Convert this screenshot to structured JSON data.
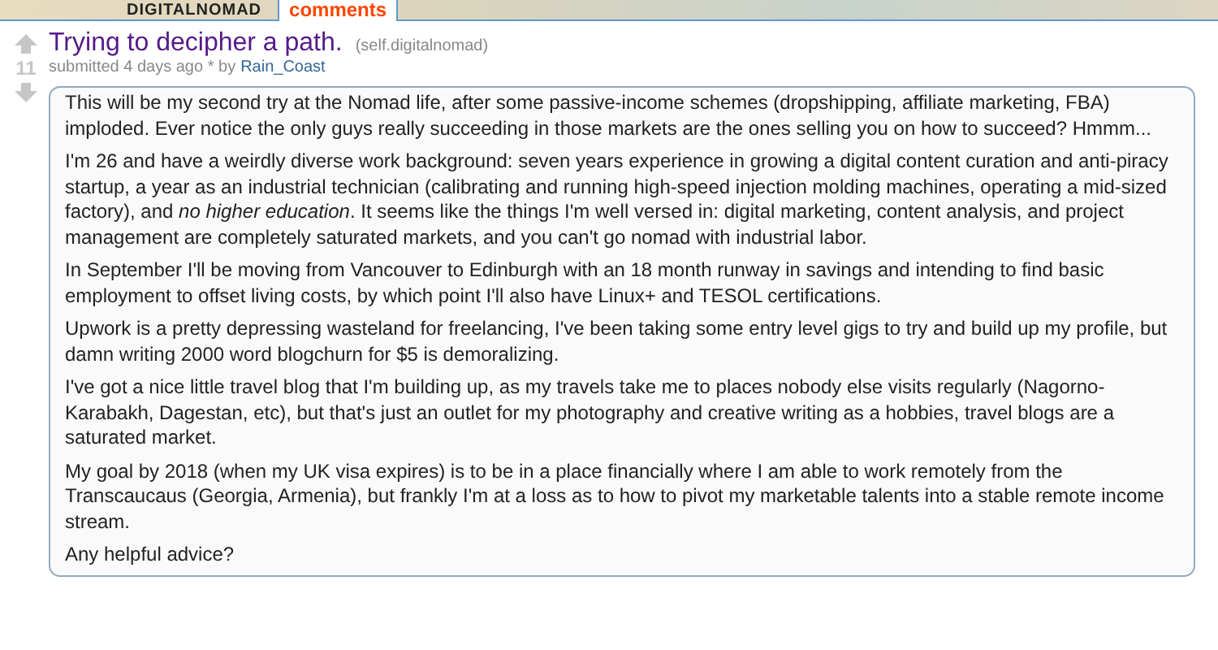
{
  "header": {
    "subreddit": "DIGITALNOMAD",
    "tabs": [
      {
        "label": "comments",
        "selected": true
      }
    ]
  },
  "post": {
    "score": "11",
    "title": "Trying to decipher a path.",
    "domain": "(self.digitalnomad)",
    "submitted": "submitted 4 days ago * by",
    "author": "Rain_Coast",
    "paragraphs": [
      "This will be my second try at the Nomad life, after some passive-income schemes (dropshipping, affiliate marketing, FBA) imploded. Ever notice the only guys really succeeding in those markets are the ones selling you on how to succeed? Hmmm...",
      "I'm 26 and have a weirdly diverse work background: seven years experience in growing a digital content curation and anti-piracy startup, a year as an industrial technician (calibrating and running high-speed injection molding machines, operating a mid-sized factory), and *no higher education*. It seems like the things I'm well versed in: digital marketing, content analysis, and project management are completely saturated markets, and you can't go nomad with industrial labor.",
      "In September I'll be moving from Vancouver to Edinburgh with an 18 month runway in savings and intending to find basic employment to offset living costs, by which point I'll also have Linux+ and TESOL certifications.",
      "Upwork is a pretty depressing wasteland for freelancing, I've been taking some entry level gigs to try and build up my profile, but damn writing 2000 word blogchurn for $5 is demoralizing.",
      "I've got a nice little travel blog that I'm building up, as my travels take me to places nobody else visits regularly (Nagorno-Karabakh, Dagestan, etc), but that's just an outlet for my photography and creative writing as a hobbies, travel blogs are a saturated market.",
      "My goal by 2018 (when my UK visa expires) is to be in a place financially where I am able to work remotely from the Transcaucaus (Georgia, Armenia), but frankly I'm at a loss as to how to pivot my marketable talents into a stable remote income stream.",
      "Any helpful advice?"
    ]
  }
}
